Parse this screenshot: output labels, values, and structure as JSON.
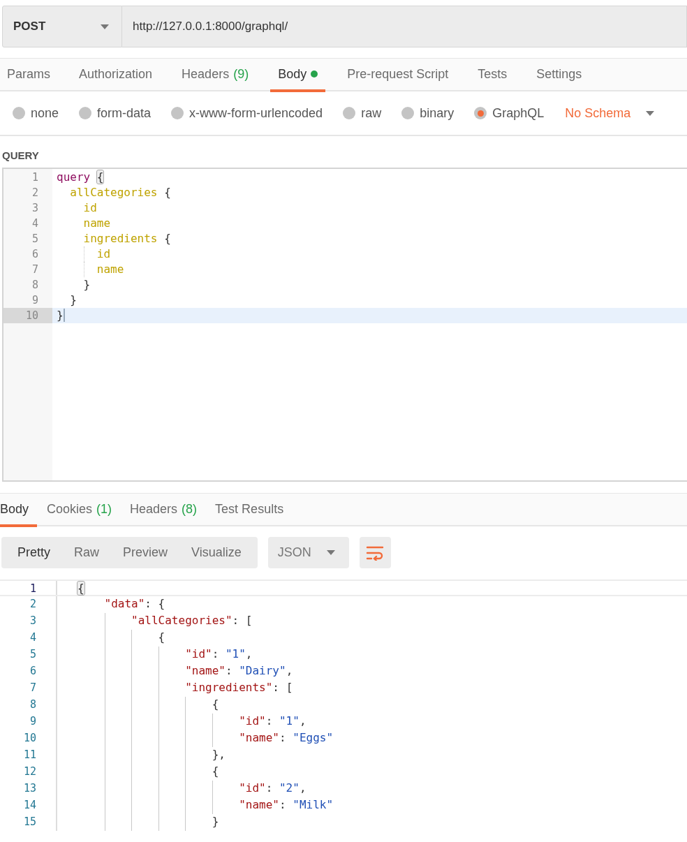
{
  "request": {
    "method": "POST",
    "url": "http://127.0.0.1:8000/graphql/"
  },
  "request_tabs": [
    {
      "label": "Params",
      "selected": false
    },
    {
      "label": "Authorization",
      "selected": false
    },
    {
      "label": "Headers",
      "count": "(9)",
      "selected": false
    },
    {
      "label": "Body",
      "selected": true,
      "indicator": true
    },
    {
      "label": "Pre-request Script",
      "selected": false
    },
    {
      "label": "Tests",
      "selected": false
    },
    {
      "label": "Settings",
      "selected": false
    }
  ],
  "body_types": [
    {
      "label": "none",
      "selected": false
    },
    {
      "label": "form-data",
      "selected": false
    },
    {
      "label": "x-www-form-urlencoded",
      "selected": false
    },
    {
      "label": "raw",
      "selected": false
    },
    {
      "label": "binary",
      "selected": false
    },
    {
      "label": "GraphQL",
      "selected": true
    }
  ],
  "schema_select": {
    "value": "No Schema"
  },
  "query": {
    "label": "QUERY",
    "lines": [
      {
        "number": "1",
        "selected": false,
        "tokens": [
          {
            "kind": "keyword",
            "text": "query"
          },
          {
            "kind": "match",
            "text": "{"
          }
        ]
      },
      {
        "number": "2",
        "selected": false,
        "tokens": [
          {
            "kind": "field",
            "text": "  allCategories"
          },
          {
            "kind": "punct",
            "text": " {"
          }
        ]
      },
      {
        "number": "3",
        "selected": false,
        "tokens": [
          {
            "kind": "field",
            "text": "    id"
          }
        ]
      },
      {
        "number": "4",
        "selected": false,
        "tokens": [
          {
            "kind": "field",
            "text": "    name"
          }
        ]
      },
      {
        "number": "5",
        "selected": false,
        "tokens": [
          {
            "kind": "field",
            "text": "    ingredients"
          },
          {
            "kind": "punct",
            "text": " {"
          }
        ]
      },
      {
        "number": "6",
        "selected": false,
        "tokens": [
          {
            "kind": "field",
            "text": "      id"
          }
        ]
      },
      {
        "number": "7",
        "selected": false,
        "tokens": [
          {
            "kind": "field",
            "text": "      name"
          }
        ]
      },
      {
        "number": "8",
        "selected": false,
        "tokens": [
          {
            "kind": "punct",
            "text": "    }"
          }
        ]
      },
      {
        "number": "9",
        "selected": false,
        "tokens": [
          {
            "kind": "punct",
            "text": "  }"
          }
        ]
      },
      {
        "number": "10",
        "selected": true,
        "tokens": [
          {
            "kind": "punct",
            "text": "}"
          }
        ]
      }
    ]
  },
  "response_tabs": [
    {
      "label": "Body",
      "selected": true
    },
    {
      "label": "Cookies",
      "count": "(1)",
      "selected": false
    },
    {
      "label": "Headers",
      "count": "(8)",
      "selected": false
    },
    {
      "label": "Test Results",
      "selected": false
    }
  ],
  "view_modes": [
    {
      "label": "Pretty",
      "selected": true
    },
    {
      "label": "Raw",
      "selected": false
    },
    {
      "label": "Preview",
      "selected": false
    },
    {
      "label": "Visualize",
      "selected": false
    }
  ],
  "format_select": {
    "value": "JSON"
  },
  "wrap_lines": {
    "on": true
  },
  "response": {
    "lines": [
      {
        "number": "1",
        "selected": true,
        "tokens": [
          {
            "kind": "match",
            "text": "{"
          }
        ]
      },
      {
        "number": "2",
        "selected": false,
        "tokens": [
          {
            "kind": "key",
            "text": "    \"data\""
          },
          {
            "kind": "punct",
            "text": ": {"
          }
        ]
      },
      {
        "number": "3",
        "selected": false,
        "tokens": [
          {
            "kind": "key",
            "text": "        \"allCategories\""
          },
          {
            "kind": "punct",
            "text": ": ["
          }
        ]
      },
      {
        "number": "4",
        "selected": false,
        "tokens": [
          {
            "kind": "punct",
            "text": "            {"
          }
        ]
      },
      {
        "number": "5",
        "selected": false,
        "tokens": [
          {
            "kind": "key",
            "text": "                \"id\""
          },
          {
            "kind": "punct",
            "text": ": "
          },
          {
            "kind": "string",
            "text": "\"1\""
          },
          {
            "kind": "punct",
            "text": ","
          }
        ]
      },
      {
        "number": "6",
        "selected": false,
        "tokens": [
          {
            "kind": "key",
            "text": "                \"name\""
          },
          {
            "kind": "punct",
            "text": ": "
          },
          {
            "kind": "string",
            "text": "\"Dairy\""
          },
          {
            "kind": "punct",
            "text": ","
          }
        ]
      },
      {
        "number": "7",
        "selected": false,
        "tokens": [
          {
            "kind": "key",
            "text": "                \"ingredients\""
          },
          {
            "kind": "punct",
            "text": ": ["
          }
        ]
      },
      {
        "number": "8",
        "selected": false,
        "tokens": [
          {
            "kind": "punct",
            "text": "                    {"
          }
        ]
      },
      {
        "number": "9",
        "selected": false,
        "tokens": [
          {
            "kind": "key",
            "text": "                        \"id\""
          },
          {
            "kind": "punct",
            "text": ": "
          },
          {
            "kind": "string",
            "text": "\"1\""
          },
          {
            "kind": "punct",
            "text": ","
          }
        ]
      },
      {
        "number": "10",
        "selected": false,
        "tokens": [
          {
            "kind": "key",
            "text": "                        \"name\""
          },
          {
            "kind": "punct",
            "text": ": "
          },
          {
            "kind": "string",
            "text": "\"Eggs\""
          }
        ]
      },
      {
        "number": "11",
        "selected": false,
        "tokens": [
          {
            "kind": "punct",
            "text": "                    },"
          }
        ]
      },
      {
        "number": "12",
        "selected": false,
        "tokens": [
          {
            "kind": "punct",
            "text": "                    {"
          }
        ]
      },
      {
        "number": "13",
        "selected": false,
        "tokens": [
          {
            "kind": "key",
            "text": "                        \"id\""
          },
          {
            "kind": "punct",
            "text": ": "
          },
          {
            "kind": "string",
            "text": "\"2\""
          },
          {
            "kind": "punct",
            "text": ","
          }
        ]
      },
      {
        "number": "14",
        "selected": false,
        "tokens": [
          {
            "kind": "key",
            "text": "                        \"name\""
          },
          {
            "kind": "punct",
            "text": ": "
          },
          {
            "kind": "string",
            "text": "\"Milk\""
          }
        ]
      },
      {
        "number": "15",
        "selected": false,
        "tokens": [
          {
            "kind": "punct",
            "text": "                    }"
          }
        ]
      }
    ]
  }
}
